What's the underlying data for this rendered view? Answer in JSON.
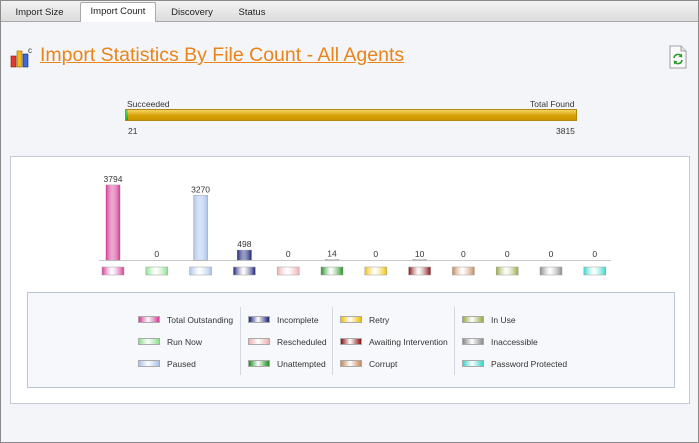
{
  "tabs": [
    {
      "label": "Import Size",
      "active": false
    },
    {
      "label": "Import Count",
      "active": true
    },
    {
      "label": "Discovery",
      "active": false
    },
    {
      "label": "Status",
      "active": false
    }
  ],
  "page_title": "Import Statistics By File Count - All Agents",
  "progress": {
    "left_label": "Succeeded",
    "right_label": "Total Found",
    "left_value": "21",
    "right_value": "3815",
    "fill_fraction": 0.0055,
    "track_color": "#d7a205",
    "fill_color": "#18a818"
  },
  "icons": {
    "title": "bar-chart-icon",
    "refresh": "refresh-document-icon"
  },
  "chart_data": {
    "type": "bar",
    "categories": [
      "Total Outstanding",
      "Run Now",
      "Paused",
      "Incomplete",
      "Rescheduled",
      "Unattempted",
      "Retry",
      "Awaiting Intervention",
      "Corrupt",
      "In Use",
      "Inaccessible",
      "Password Protected"
    ],
    "values": [
      3794,
      0,
      3270,
      498,
      0,
      14,
      0,
      10,
      0,
      0,
      0,
      0
    ],
    "labels": [
      "3794",
      "0",
      "3270",
      "498",
      "0",
      "14",
      "0",
      "10",
      "0",
      "0",
      "0",
      "0"
    ],
    "colors": [
      "#d63a96",
      "#8ee08e",
      "#a9c2ec",
      "#1a2378",
      "#eeb0b0",
      "#1e8f1e",
      "#f0c000",
      "#8a1010",
      "#c8875a",
      "#9aaa40",
      "#8a8a8a",
      "#38d8c8"
    ],
    "ylim": [
      0,
      3794
    ],
    "legend_placement": "bottom"
  },
  "legend": {
    "items": [
      "Total Outstanding",
      "Run Now",
      "Paused",
      "Incomplete",
      "Rescheduled",
      "Unattempted",
      "Retry",
      "Awaiting Intervention",
      "Corrupt",
      "In Use",
      "Inaccessible",
      "Password Protected"
    ]
  }
}
